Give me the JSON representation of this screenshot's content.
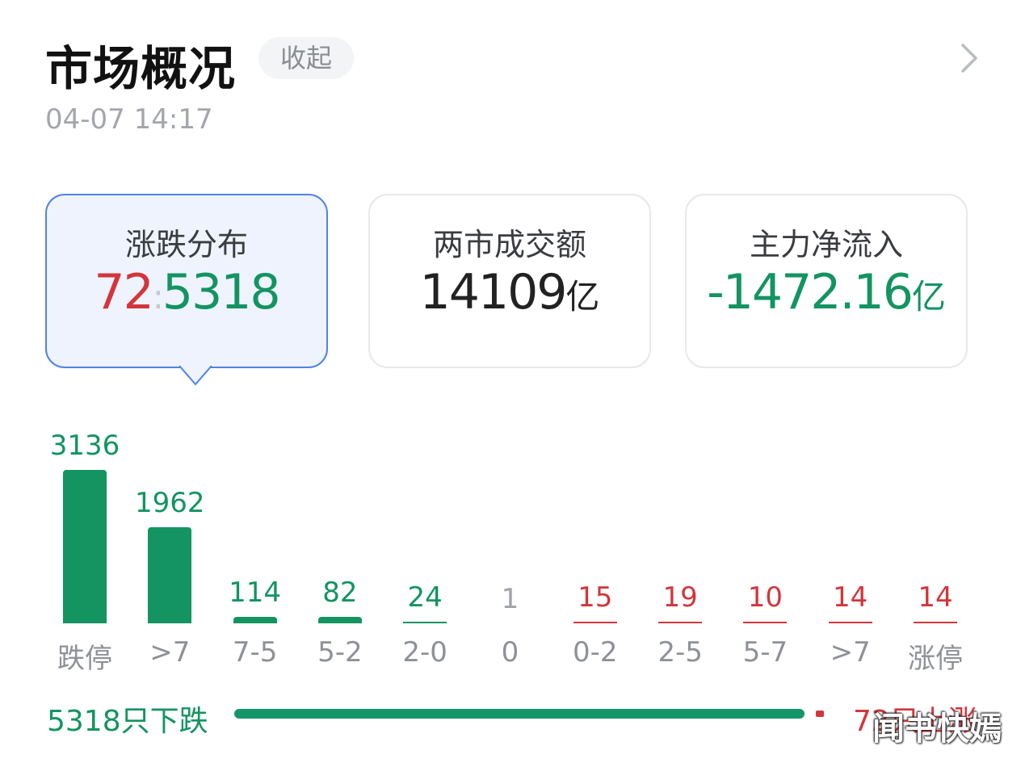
{
  "header": {
    "title": "市场概况",
    "collapse_label": "收起",
    "timestamp": "04-07 14:17"
  },
  "cards": [
    {
      "label": "涨跌分布",
      "up": "72",
      "sep": ":",
      "down": "5318",
      "active": true
    },
    {
      "label": "两市成交额",
      "value": "14109",
      "unit": "亿",
      "active": false
    },
    {
      "label": "主力净流入",
      "value": "-1472.16",
      "unit": "亿",
      "active": false
    }
  ],
  "colors": {
    "up": "#d2363c",
    "down": "#139461",
    "neutral": "#8e9196",
    "accent": "#4f83e6"
  },
  "chart_data": {
    "type": "bar",
    "categories": [
      "跌停",
      ">7",
      "7-5",
      "5-2",
      "2-0",
      "0",
      "0-2",
      "2-5",
      "5-7",
      ">7",
      "涨停"
    ],
    "values": [
      3136,
      1962,
      114,
      82,
      24,
      1,
      15,
      19,
      10,
      14,
      14
    ],
    "value_labels": [
      "3136",
      "1962",
      "114",
      "82",
      "24",
      "1",
      "15",
      "19",
      "10",
      "14",
      "14"
    ],
    "directions": [
      "down",
      "down",
      "down",
      "down",
      "down",
      "flat",
      "up",
      "up",
      "up",
      "up",
      "up"
    ]
  },
  "summary": {
    "down_text": "5318只下跌",
    "up_text": "72只上涨",
    "down_count": 5318,
    "up_count": 72
  },
  "watermark": "闻书快嫣"
}
